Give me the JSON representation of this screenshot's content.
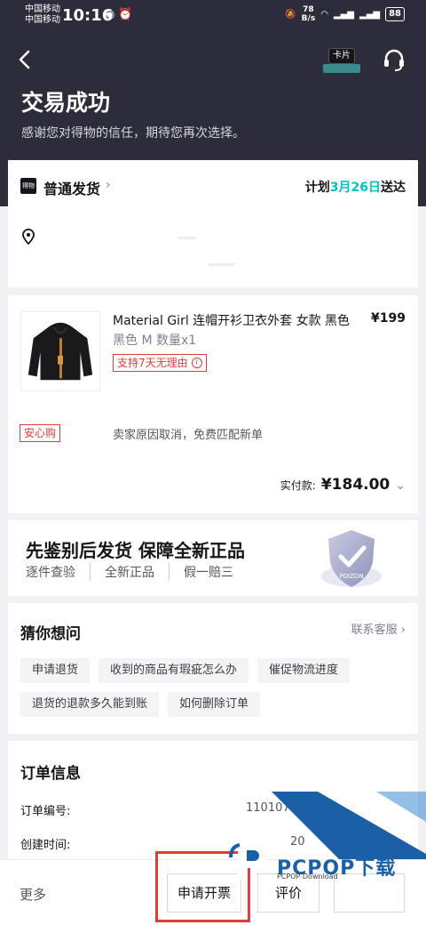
{
  "status_bar": {
    "carrier1": "中国移动",
    "carrier2": "中国移动",
    "time": "10:16",
    "net_speed_top": "78",
    "net_speed_bottom": "B/s",
    "battery": "88"
  },
  "header": {
    "title": "交易成功",
    "subtitle": "感谢您对得物的信任，期待您再次选择。",
    "card_label": "卡片"
  },
  "shipping": {
    "logo_text": "得物",
    "method": "普通发货",
    "plan_prefix": "计划",
    "plan_date": "3月26日",
    "plan_suffix": "送达"
  },
  "product": {
    "name": "Material Girl 连帽开衫卫衣外套 女款 黑色",
    "price": "¥199",
    "spec": "黑色 M 数量x1",
    "return_badge": "支持7天无理由",
    "anxin_tag": "安心购",
    "cancel_note": "卖家原因取消，免费匹配新单",
    "paid_label": "实付款:",
    "paid_amount": "¥184.00"
  },
  "promo": {
    "title": "先鉴别后发货  保障全新正品",
    "items": [
      "逐件查验",
      "全新正品",
      "假一赔三"
    ],
    "shield_text": "POIZON"
  },
  "guess": {
    "title": "猜你想问",
    "service_link": "联系客服",
    "chips": [
      "申请退货",
      "收到的商品有瑕疵怎么办",
      "催促物流进度",
      "退货的退款多久能到账",
      "如何删除订单"
    ]
  },
  "order_info": {
    "title": "订单信息",
    "rows": [
      {
        "label": "订单编号:",
        "value": "110107"
      },
      {
        "label": "创建时间:",
        "value": "20"
      }
    ]
  },
  "bottom_bar": {
    "more": "更多",
    "invoice_button": "申请开票",
    "review_button": "评价"
  },
  "watermark": {
    "text": "PCPOP下载",
    "sub": "PCPOP Download"
  },
  "colors": {
    "header_bg": "#2c2c3a",
    "accent_green": "#01c2c3",
    "warning_red": "#e23a3a",
    "highlight_box": "#e33a3a",
    "watermark_blue": "#1b5fa6"
  }
}
